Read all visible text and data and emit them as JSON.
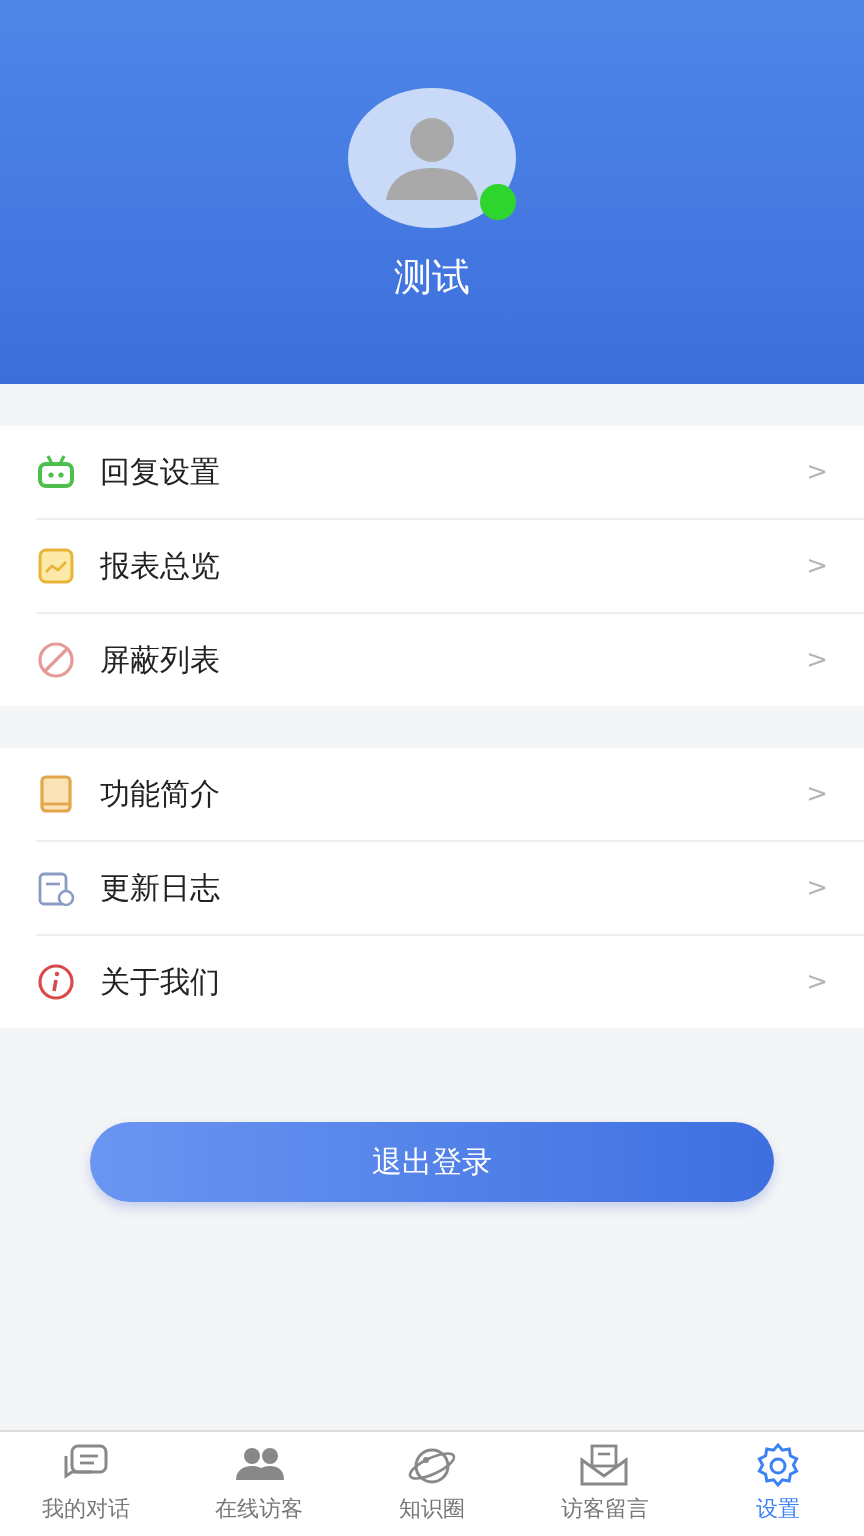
{
  "profile": {
    "name": "测试",
    "online": true
  },
  "menu_groups": [
    {
      "items": [
        {
          "label": "回复设置",
          "chevron": ">"
        },
        {
          "label": "报表总览",
          "chevron": ">"
        },
        {
          "label": "屏蔽列表",
          "chevron": ">"
        }
      ]
    },
    {
      "items": [
        {
          "label": "功能简介",
          "chevron": ">"
        },
        {
          "label": "更新日志",
          "chevron": ">"
        },
        {
          "label": "关于我们",
          "chevron": ">"
        }
      ]
    }
  ],
  "logout_button": "退出登录",
  "tab_bar": [
    {
      "label": "我的对话",
      "selected": false
    },
    {
      "label": "在线访客",
      "selected": false
    },
    {
      "label": "知识圈",
      "selected": false
    },
    {
      "label": "访客留言",
      "selected": false
    },
    {
      "label": "设置",
      "selected": true
    }
  ]
}
